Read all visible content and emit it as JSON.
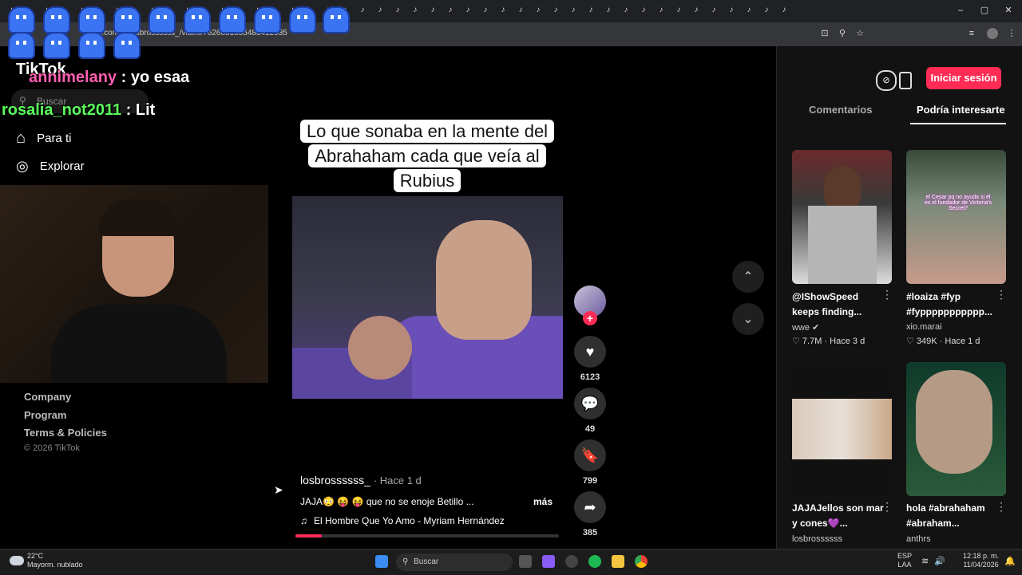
{
  "browser": {
    "url": "tiktok.com/@losbrossssss_/video/7626881855488412935",
    "tab_icon": "tiktok-icon"
  },
  "overlay": {
    "chat": [
      {
        "user": "annimelany",
        "user_color": "#ff5fb0",
        "message": ": yo esaa"
      },
      {
        "user": "rosalia_not2011",
        "user_color": "#5bff5b",
        "message": ": Lit"
      }
    ]
  },
  "sidebar": {
    "logo": "TikTok",
    "search_placeholder": "Buscar",
    "nav": [
      {
        "label": "Para ti",
        "icon": "home-icon"
      },
      {
        "label": "Explorar",
        "icon": "compass-icon"
      }
    ],
    "footer": {
      "company": "Company",
      "program": "Program",
      "terms": "Terms & Policies",
      "copyright": "© 2026 TikTok"
    }
  },
  "video": {
    "caption": "Lo que sonaba en la mente del Abrahaham cada que veía al Rubius",
    "author": "losbrossssss_",
    "time": "· Hace 1 d",
    "description": "JAJA😳 😝 😝  que no se enoje Betillo ...",
    "more": "más",
    "music": "El Hombre Que Yo Amo - Myriam Hernández",
    "progress": 0.1
  },
  "actions": {
    "likes": "6123",
    "comments": "49",
    "saves": "799",
    "shares": "385"
  },
  "panel": {
    "login": "Iniciar sesión",
    "tabs": [
      "Comentarios",
      "Podría interesarte"
    ],
    "items": [
      {
        "title": "@IShowSpeed keeps finding...",
        "user": "wwe ✔",
        "likes": "♡ 7.7M",
        "time": "Hace 3 d"
      },
      {
        "title": "#loaiza #fyp #fyppppppppppp...",
        "user": "xio.marai",
        "likes": "♡ 349K",
        "time": "Hace 1 d",
        "thumb_text": "el Cesar pq no ayuda si él es el fundador de Victoria's Secret?"
      },
      {
        "title": "JAJAJellos son mar y cones💜...",
        "user": "losbrossssss"
      },
      {
        "title": "hola #abrahaham #abraham...",
        "user": "anthrs"
      }
    ]
  },
  "taskbar": {
    "temp": "22°C",
    "weather": "Mayorm. nublado",
    "search": "Buscar",
    "lang1": "ESP",
    "lang2": "LAA",
    "time": "12:18 p. m.",
    "date": "11/04/2026"
  }
}
